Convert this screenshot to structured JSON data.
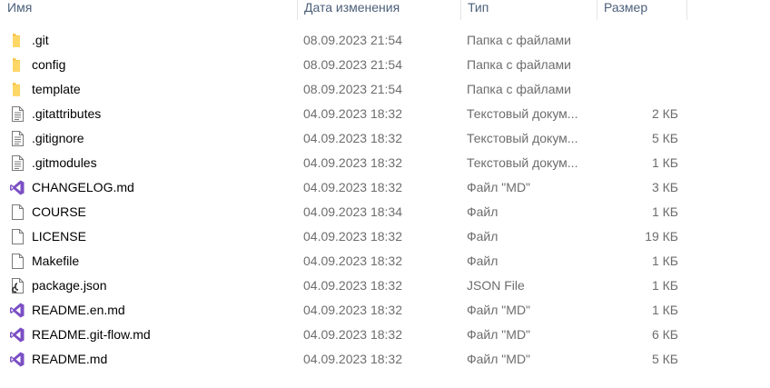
{
  "columns": {
    "name": "Имя",
    "date": "Дата изменения",
    "type": "Тип",
    "size": "Размер"
  },
  "colors": {
    "folder": "#f8c850",
    "vs_purple": "#7b4fc4",
    "header_text": "#4c607a",
    "meta_text": "#6d6d6d"
  },
  "files": [
    {
      "icon": "folder-icon",
      "name": ".git",
      "date": "08.09.2023 21:54",
      "type": "Папка с файлами",
      "size": ""
    },
    {
      "icon": "folder-icon",
      "name": "config",
      "date": "08.09.2023 21:54",
      "type": "Папка с файлами",
      "size": ""
    },
    {
      "icon": "folder-icon",
      "name": "template",
      "date": "08.09.2023 21:54",
      "type": "Папка с файлами",
      "size": ""
    },
    {
      "icon": "text-file-icon",
      "name": ".gitattributes",
      "date": "04.09.2023 18:32",
      "type": "Текстовый докум...",
      "size": "2 КБ"
    },
    {
      "icon": "text-file-icon",
      "name": ".gitignore",
      "date": "04.09.2023 18:32",
      "type": "Текстовый докум...",
      "size": "5 КБ"
    },
    {
      "icon": "text-file-icon",
      "name": ".gitmodules",
      "date": "04.09.2023 18:32",
      "type": "Текстовый докум...",
      "size": "1 КБ"
    },
    {
      "icon": "visual-studio-icon",
      "name": "CHANGELOG.md",
      "date": "04.09.2023 18:32",
      "type": "Файл \"MD\"",
      "size": "3 КБ"
    },
    {
      "icon": "blank-file-icon",
      "name": "COURSE",
      "date": "04.09.2023 18:34",
      "type": "Файл",
      "size": "1 КБ"
    },
    {
      "icon": "blank-file-icon",
      "name": "LICENSE",
      "date": "04.09.2023 18:32",
      "type": "Файл",
      "size": "19 КБ"
    },
    {
      "icon": "blank-file-icon",
      "name": "Makefile",
      "date": "04.09.2023 18:32",
      "type": "Файл",
      "size": "1 КБ"
    },
    {
      "icon": "json-file-icon",
      "name": "package.json",
      "date": "04.09.2023 18:32",
      "type": "JSON File",
      "size": "1 КБ"
    },
    {
      "icon": "visual-studio-icon",
      "name": "README.en.md",
      "date": "04.09.2023 18:32",
      "type": "Файл \"MD\"",
      "size": "1 КБ"
    },
    {
      "icon": "visual-studio-icon",
      "name": "README.git-flow.md",
      "date": "04.09.2023 18:32",
      "type": "Файл \"MD\"",
      "size": "6 КБ"
    },
    {
      "icon": "visual-studio-icon",
      "name": "README.md",
      "date": "04.09.2023 18:32",
      "type": "Файл \"MD\"",
      "size": "5 КБ"
    }
  ]
}
